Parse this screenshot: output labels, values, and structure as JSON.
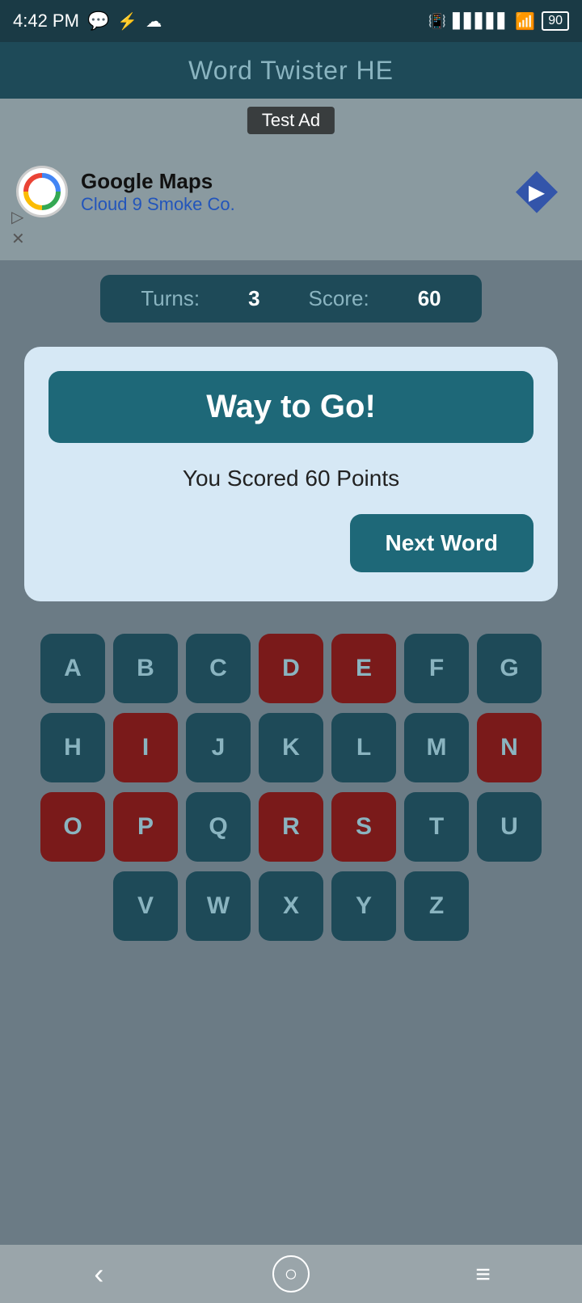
{
  "statusBar": {
    "time": "4:42 PM",
    "battery": "90"
  },
  "header": {
    "title": "Word Twister HE"
  },
  "ad": {
    "label": "Test Ad",
    "company": "Google Maps",
    "subtitle": "Cloud 9 Smoke Co."
  },
  "score": {
    "turnsLabel": "Turns:",
    "turnsValue": "3",
    "scoreLabel": "Score:",
    "scoreValue": "60"
  },
  "dialog": {
    "title": "Way to Go!",
    "bodyText": "You Scored 60 Points",
    "nextWordButton": "Next Word"
  },
  "keyboard": {
    "rows": [
      [
        {
          "letter": "A",
          "used": false
        },
        {
          "letter": "B",
          "used": false
        },
        {
          "letter": "C",
          "used": false
        },
        {
          "letter": "D",
          "used": true
        },
        {
          "letter": "E",
          "used": true
        },
        {
          "letter": "F",
          "used": false
        },
        {
          "letter": "G",
          "used": false
        }
      ],
      [
        {
          "letter": "H",
          "used": false
        },
        {
          "letter": "I",
          "used": true
        },
        {
          "letter": "J",
          "used": false
        },
        {
          "letter": "K",
          "used": false
        },
        {
          "letter": "L",
          "used": false
        },
        {
          "letter": "M",
          "used": false
        },
        {
          "letter": "N",
          "used": true
        }
      ],
      [
        {
          "letter": "O",
          "used": true
        },
        {
          "letter": "P",
          "used": true
        },
        {
          "letter": "Q",
          "used": false
        },
        {
          "letter": "R",
          "used": true
        },
        {
          "letter": "S",
          "used": true
        },
        {
          "letter": "T",
          "used": false
        },
        {
          "letter": "U",
          "used": false
        }
      ],
      [
        {
          "letter": "V",
          "used": false
        },
        {
          "letter": "W",
          "used": false
        },
        {
          "letter": "X",
          "used": false
        },
        {
          "letter": "Y",
          "used": false
        },
        {
          "letter": "Z",
          "used": false
        }
      ]
    ]
  },
  "navbar": {
    "backLabel": "‹",
    "homeLabel": "○",
    "menuLabel": "≡"
  },
  "colors": {
    "keyUsed": "#7a1a1a",
    "keyNormal": "#1e4a58",
    "dialogBg": "#d6e8f5",
    "headerBg": "#1e4a58",
    "accent": "#1e6878"
  }
}
